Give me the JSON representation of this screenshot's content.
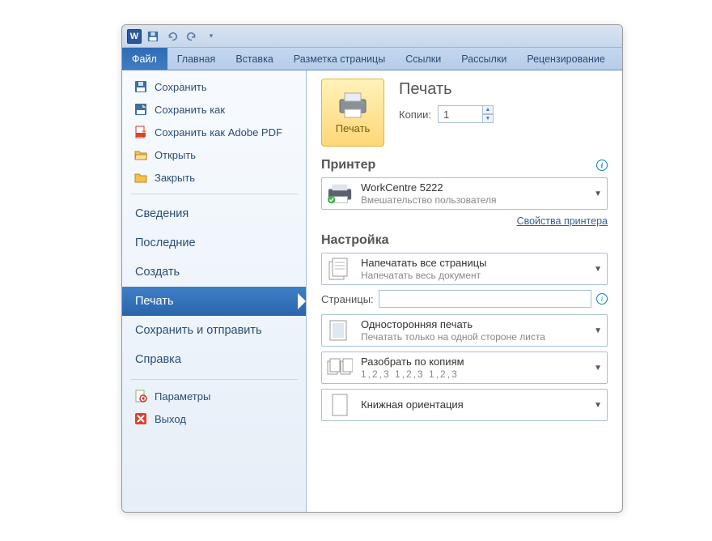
{
  "qat": {
    "app_letter": "W"
  },
  "ribbon": {
    "tabs": [
      "Файл",
      "Главная",
      "Вставка",
      "Разметка страницы",
      "Ссылки",
      "Рассылки",
      "Рецензирование"
    ],
    "active_index": 0
  },
  "side_actions": [
    {
      "label": "Сохранить",
      "icon": "save"
    },
    {
      "label": "Сохранить как",
      "icon": "saveas"
    },
    {
      "label": "Сохранить как Adobe PDF",
      "icon": "pdf"
    },
    {
      "label": "Открыть",
      "icon": "open"
    },
    {
      "label": "Закрыть",
      "icon": "close-folder"
    }
  ],
  "side_sections": [
    {
      "label": "Сведения"
    },
    {
      "label": "Последние"
    },
    {
      "label": "Создать"
    },
    {
      "label": "Печать",
      "selected": true
    },
    {
      "label": "Сохранить и отправить"
    },
    {
      "label": "Справка"
    }
  ],
  "side_footer": [
    {
      "label": "Параметры",
      "icon": "settings-doc"
    },
    {
      "label": "Выход",
      "icon": "exit"
    }
  ],
  "print": {
    "title": "Печать",
    "button_label": "Печать",
    "copies_label": "Копии:",
    "copies_value": "1"
  },
  "printer_section": {
    "header": "Принтер",
    "name": "WorkCentre 5222",
    "status": "Вмешательство пользователя",
    "properties_link": "Свойства принтера"
  },
  "settings_section": {
    "header": "Настройка",
    "range": {
      "title": "Напечатать все страницы",
      "sub": "Напечатать весь документ"
    },
    "pages_label": "Страницы:",
    "pages_value": "",
    "duplex": {
      "title": "Односторонняя печать",
      "sub": "Печатать только на одной стороне листа"
    },
    "collate": {
      "title": "Разобрать по копиям",
      "sub": "1,2,3    1,2,3    1,2,3"
    },
    "orientation": {
      "title": "Книжная ориентация"
    }
  }
}
